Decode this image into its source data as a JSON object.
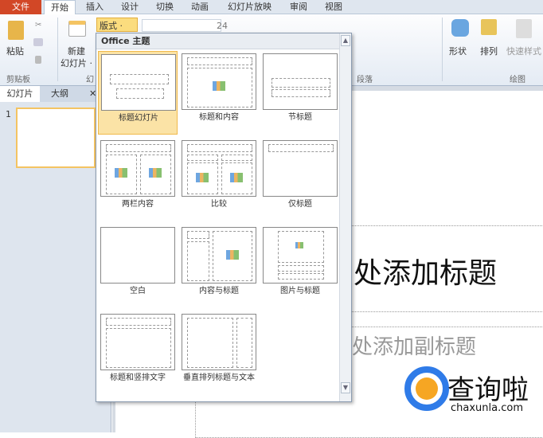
{
  "tabs": [
    "文件",
    "开始",
    "插入",
    "设计",
    "切换",
    "动画",
    "幻灯片放映",
    "审阅",
    "视图"
  ],
  "ribbon": {
    "paste": "粘贴",
    "new_slide_1": "新建",
    "new_slide_2": "幻灯片 ·",
    "layout": "版式 ·",
    "font_size": "24",
    "shape": "形状",
    "arrange": "排列",
    "quick_styles": "快速样式",
    "groups": {
      "clipboard": "剪贴板",
      "slides": "幻",
      "paragraph": "段落",
      "drawing": "绘图"
    }
  },
  "pane": {
    "tabs": [
      "幻灯片",
      "大纲"
    ],
    "close": "✕",
    "slide_number": "1"
  },
  "dropdown": {
    "header": "Office 主题",
    "layouts": [
      "标题幻灯片",
      "标题和内容",
      "节标题",
      "两栏内容",
      "比较",
      "仅标题",
      "空白",
      "内容与标题",
      "图片与标题",
      "标题和竖排文字",
      "垂直排列标题与文本"
    ],
    "selected": "标题幻灯片"
  },
  "slide": {
    "title": "处添加标题",
    "subtitle": "处添加副标题"
  },
  "watermark": {
    "name": "查询啦",
    "url": "chaxunla.com"
  },
  "colors": {
    "file_tab": "#d24726",
    "selection": "#fbe3a6",
    "accent": "#f0b94b"
  }
}
